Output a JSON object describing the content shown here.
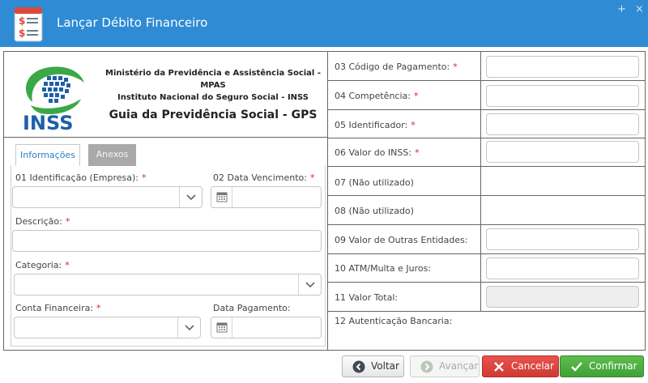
{
  "window": {
    "title": "Lançar Débito Financeiro",
    "controls": {
      "plus": "+",
      "close": "×"
    }
  },
  "header": {
    "logo_text": "INSS",
    "org_line1": "Ministério da Previdência e Assistência Social - MPAS",
    "org_line2": "Instituto Nacional do Seguro Social - INSS",
    "form_title": "Guia da Previdência Social - GPS"
  },
  "tabs": [
    {
      "label": "Informações",
      "active": true
    },
    {
      "label": "Anexos",
      "active": false
    }
  ],
  "form": {
    "identificacao": {
      "label": "01 Identificação (Empresa):",
      "required": "*",
      "value": ""
    },
    "data_vencimento": {
      "label": "02 Data Vencimento:",
      "required": "*",
      "value": ""
    },
    "descricao": {
      "label": "Descrição:",
      "required": "*",
      "value": ""
    },
    "categoria": {
      "label": "Categoria:",
      "required": "*",
      "value": ""
    },
    "conta_financeira": {
      "label": "Conta Financeira:",
      "required": "*",
      "value": ""
    },
    "data_pagamento": {
      "label": "Data Pagamento:",
      "value": ""
    }
  },
  "right_rows": [
    {
      "label": "03 Código de Pagamento:",
      "required": "*",
      "value": ""
    },
    {
      "label": "04 Competência:",
      "required": "*",
      "value": ""
    },
    {
      "label": "05 Identificador:",
      "required": "*",
      "value": ""
    },
    {
      "label": "06 Valor do INSS:",
      "required": "*",
      "value": ""
    },
    {
      "label": "07 (Não utilizado)"
    },
    {
      "label": "08 (Não utilizado)"
    },
    {
      "label": "09 Valor de Outras Entidades:",
      "value": ""
    },
    {
      "label": "10 ATM/Multa e Juros:",
      "value": ""
    },
    {
      "label": "11 Valor Total:",
      "value": ""
    },
    {
      "label": "12 Autenticação Bancaria:"
    }
  ],
  "buttons": {
    "voltar": "Voltar",
    "avancar": "Avançar",
    "cancelar": "Cancelar",
    "confirmar": "Confirmar"
  },
  "colors": {
    "titlebar": "#2e8bd4",
    "logo_green": "#3aa846",
    "logo_blue": "#1e5fa8",
    "required": "#e02020",
    "cancel": "#d9403b",
    "confirm": "#4caf42"
  }
}
